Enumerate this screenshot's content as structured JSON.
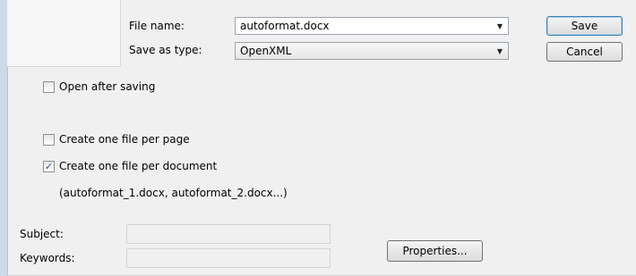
{
  "file_name": {
    "label": "File name:",
    "value": "autoformat.docx"
  },
  "save_as_type": {
    "label": "Save as type:",
    "value": "OpenXML"
  },
  "buttons": {
    "save": "Save",
    "cancel": "Cancel",
    "properties": "Properties..."
  },
  "options": {
    "open_after_saving": {
      "label": "Open after saving",
      "checked": false
    },
    "one_file_per_page": {
      "label": "Create one file per page",
      "checked": false
    },
    "one_file_per_document": {
      "label": "Create one file per document",
      "checked": true
    },
    "example": "(autoformat_1.docx, autoformat_2.docx...)"
  },
  "metadata": {
    "subject_label": "Subject:",
    "subject_value": "",
    "keywords_label": "Keywords:",
    "keywords_value": ""
  },
  "icons": {
    "dropdown": "chevron-down-icon",
    "check": "checkmark-icon"
  }
}
